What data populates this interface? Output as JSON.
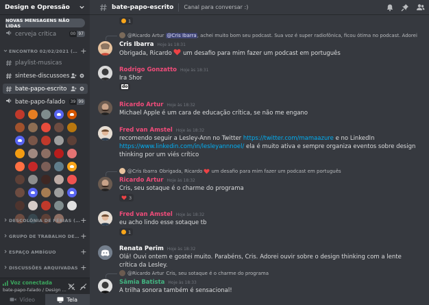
{
  "server": {
    "name": "Design e Opressão"
  },
  "sidebar": {
    "new_messages_pill": "NOVAS MENSAGENS NÃO LIDAS",
    "top_channel": {
      "label": "cerveja crítica",
      "count_a": "00",
      "count_b": "97"
    },
    "category_1": "ENCONTRO 02/02/2021 (18H-20...",
    "channels": [
      {
        "label": "playlist-musicas"
      },
      {
        "label": "sintese-discussoes"
      },
      {
        "label": "bate-papo-escrito"
      }
    ],
    "voice_channel": {
      "label": "bate-papo-falado",
      "count_a": "39",
      "count_b": "99"
    },
    "categories": [
      "DESCOLÔNIA DE FÉRIAS (01/12/2...",
      "GRUPO DE TRABALHO DESIGN S...",
      "ESPAÇO AMBÍGUO",
      "DISCUSSÕES ARQUIVADAS"
    ],
    "voice_panel": {
      "status": "Voz conectada",
      "subtitle": "bate-papo-falado / Design ..."
    },
    "media": {
      "video_label": "Vídeo",
      "screen_label": "Tela"
    }
  },
  "topbar": {
    "channel": "bate-papo-escrito",
    "topic": "Canal para conversar :)"
  },
  "messages": {
    "top_reaction": {
      "count": "1"
    },
    "m1": {
      "reply_author": "@Ricardo Artur",
      "reply_mention": "@Cris Ibarra",
      "reply_text": ", achei muito bom seu podcast. Sua voz é super radiofônica, ficou ótima no podcast. Adorei",
      "author": "Cris Ibarra",
      "time": "Hoje às 18:31",
      "text_a": "Obrigada, Ricardo",
      "text_b": "um desafio para mim fazer um podcast em português"
    },
    "m2": {
      "author": "Rodrigo Gonzatto",
      "time": "Hoje às 18:31",
      "text": "Ira Shor",
      "reaction": "do"
    },
    "m3": {
      "author": "Ricardo Artur",
      "time": "Hoje às 18:32",
      "text": "Michael Apple é um cara de educação crítica, se não me engano"
    },
    "m4": {
      "author": "Fred van Amstel",
      "time": "Hoje às 18:32",
      "text_a": "recomendo seguir a Lesley-Ann no Twitter ",
      "link_1": "https://twitter.com/mamaazure",
      "text_b": " e no LinkedIn",
      "link_2": "https://www.linkedin.com/in/lesleyannnoel/",
      "text_c": " ela é muito ativa e sempre organiza eventos sobre design thinking por um viés crítico"
    },
    "m5": {
      "reply_author": "@Cris Ibarra",
      "reply_text_a": "Obrigada, Ricardo",
      "reply_text_b": "um desafio para mim fazer um podcast em português",
      "author": "Ricardo Artur",
      "time": "Hoje às 18:32",
      "text": "Cris, seu sotaque é o charme do programa",
      "reaction_count": "3"
    },
    "m6": {
      "author": "Fred van Amstel",
      "time": "Hoje às 18:32",
      "text": "eu acho lindo esse sotaque tb",
      "reaction_count": "1"
    },
    "m7": {
      "author": "Renata Perim",
      "time": "Hoje às 18:32",
      "text": "Olá! Ouvi ontem e gostei muito. Parabéns, Cris. Adorei ouvir sobre o design thinking com a lente crítica da Lesley."
    },
    "m8": {
      "reply_author": "@Ricardo Artur",
      "reply_text": "Cris, seu sotaque é o charme do programa",
      "author": "Sâmia Batista",
      "time": "Hoje às 18:33",
      "text": "A trilha sonora também é sensacional!"
    }
  },
  "colors": {
    "author_pink": "#f04c7a",
    "author_green": "#43b581",
    "author_white": "#ffffff",
    "link": "#00aff4",
    "heart": "#ed4245"
  }
}
